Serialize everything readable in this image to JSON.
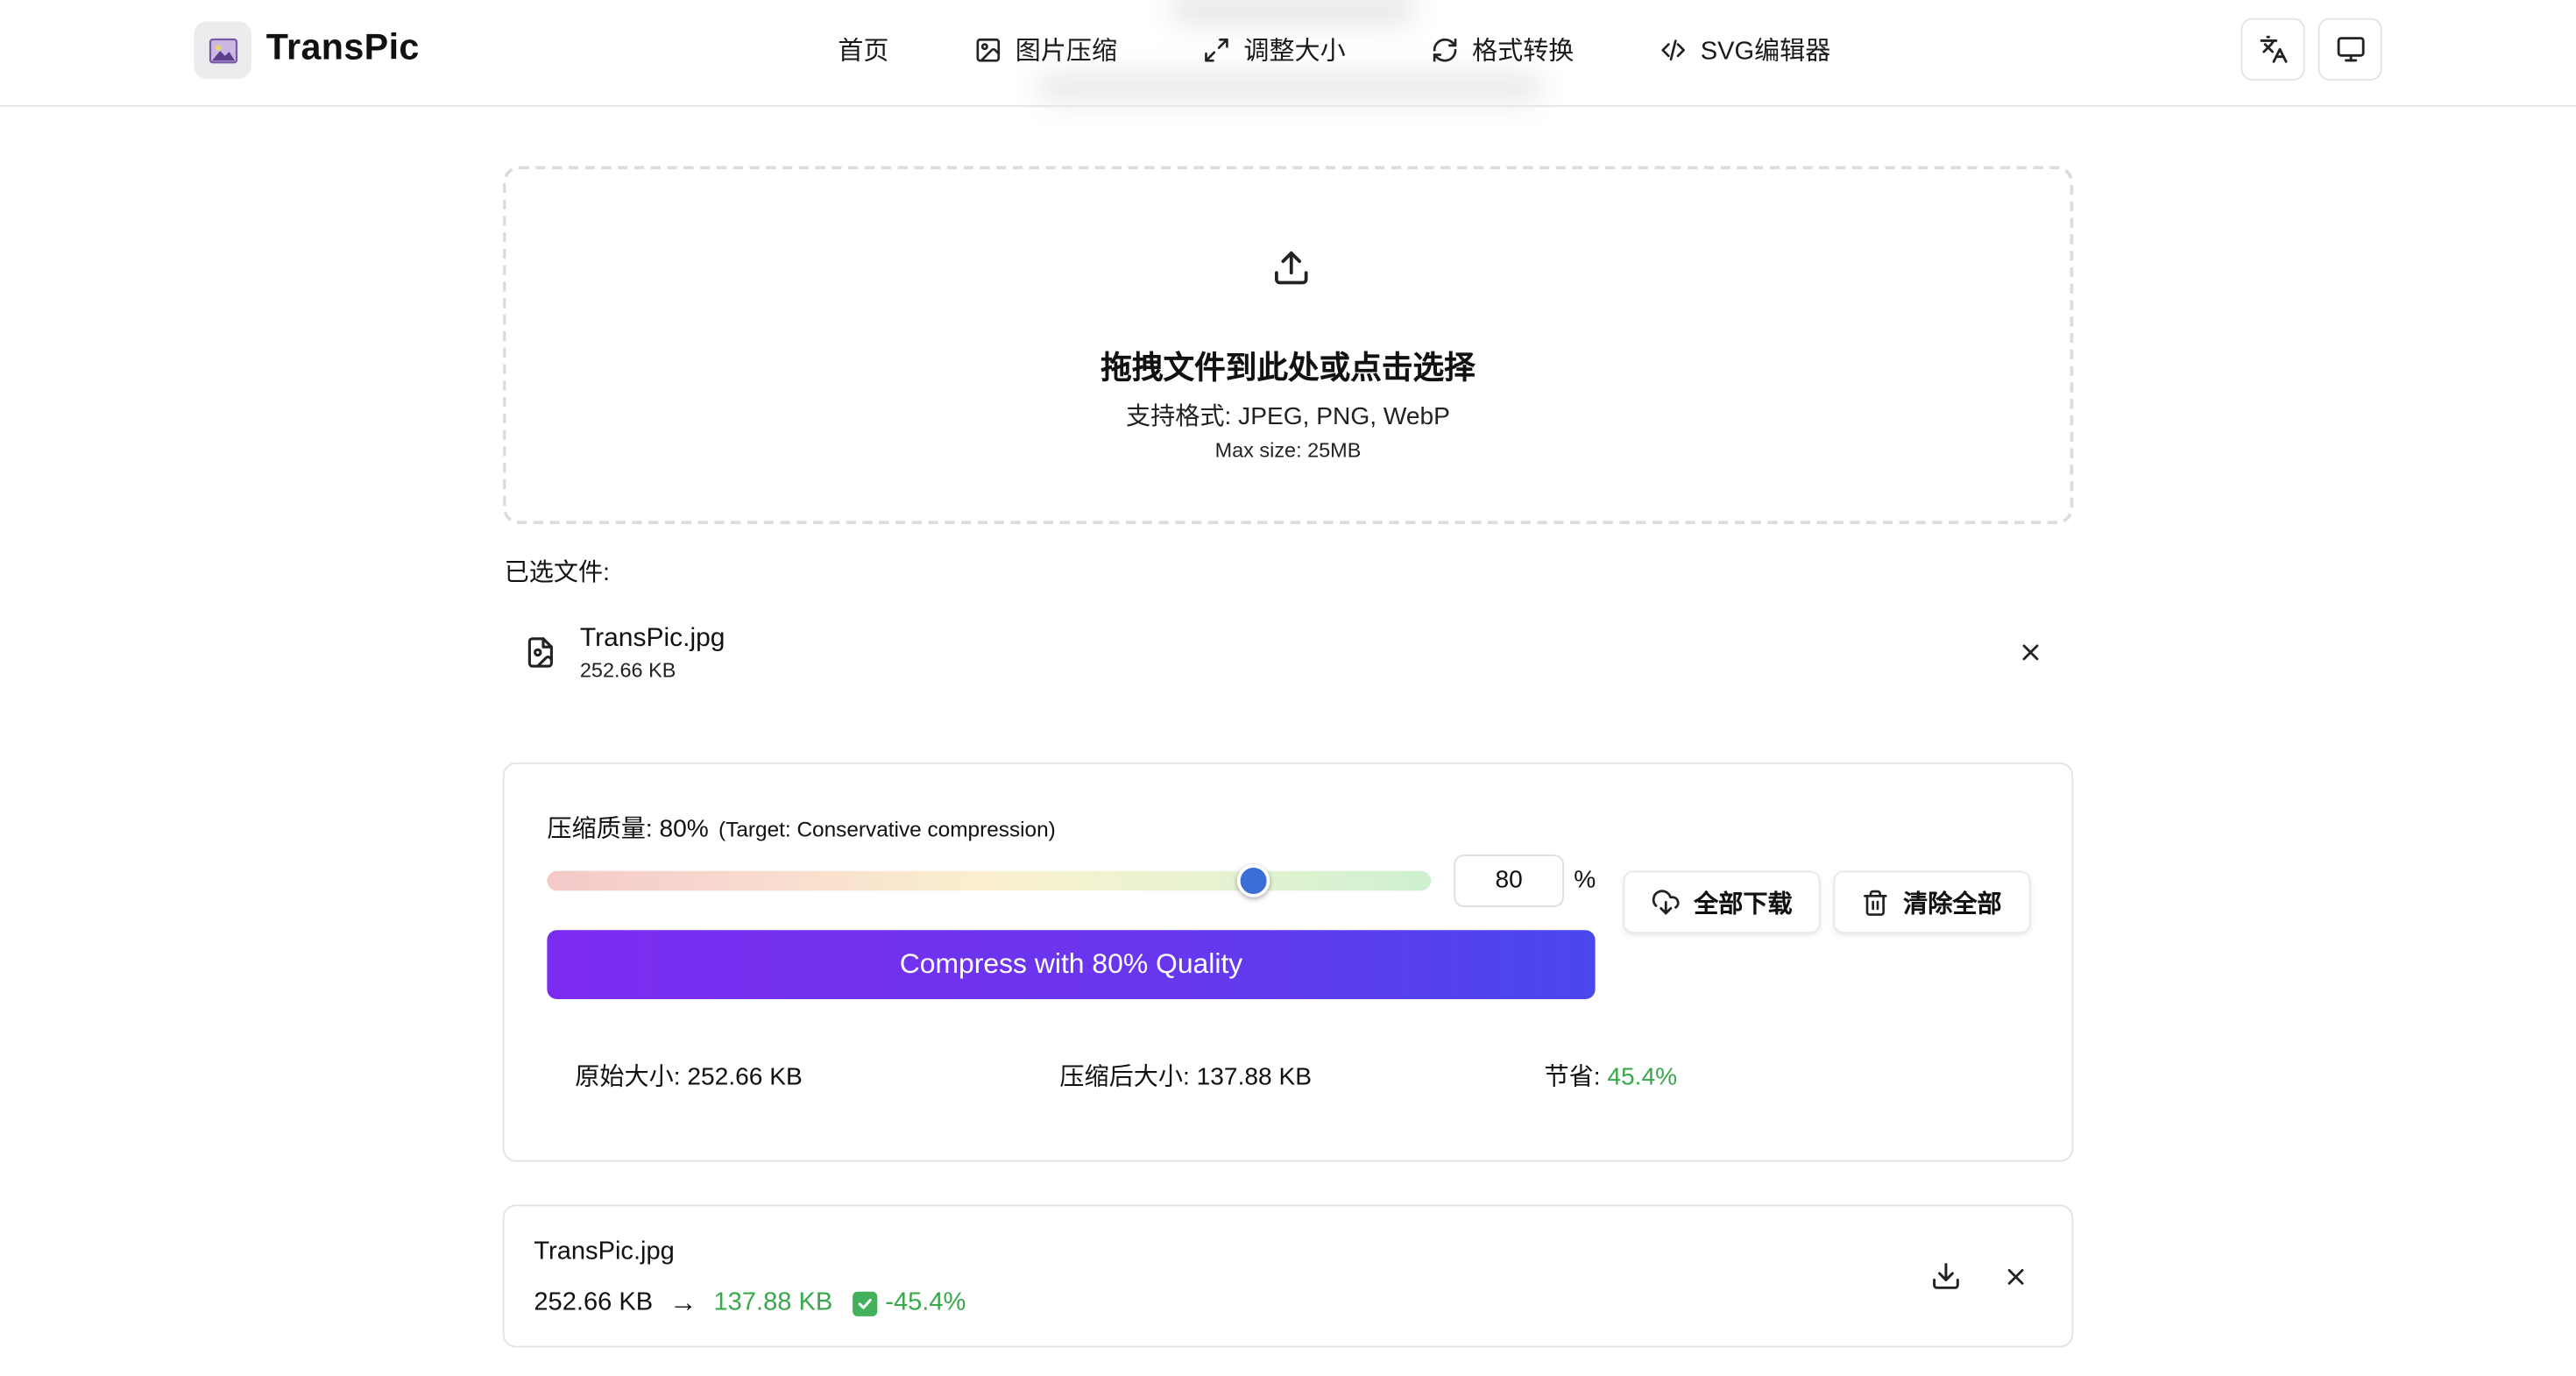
{
  "header": {
    "app_title": "TransPic",
    "nav": [
      {
        "label": "首页",
        "icon": "none"
      },
      {
        "label": "图片压缩",
        "icon": "image-icon"
      },
      {
        "label": "调整大小",
        "icon": "expand-icon"
      },
      {
        "label": "格式转换",
        "icon": "refresh-icon"
      },
      {
        "label": "SVG编辑器",
        "icon": "code-icon"
      }
    ],
    "buttons": [
      {
        "icon": "translate-icon"
      },
      {
        "icon": "monitor-icon"
      }
    ]
  },
  "upload": {
    "title": "拖拽文件到此处或点击选择",
    "formats": "支持格式: JPEG, PNG, WebP",
    "max_size": "Max size: 25MB"
  },
  "selected": {
    "label": "已选文件:",
    "file": {
      "name": "TransPic.jpg",
      "size": "252.66 KB"
    }
  },
  "compression": {
    "quality_label": "压缩质量: 80%",
    "target_note": "(Target: Conservative compression)",
    "quality_value": 80,
    "quality_input": "80",
    "percent_sign": "%",
    "compress_button": "Compress with 80% Quality",
    "download_all": "全部下载",
    "clear_all": "清除全部",
    "stats": {
      "original_label": "原始大小:",
      "original_value": "252.66 KB",
      "compressed_label": "压缩后大小:",
      "compressed_value": "137.88 KB",
      "saved_label": "节省:",
      "saved_value": "45.4%"
    },
    "colors": {
      "accent_start": "#7c2cf0",
      "accent_end": "#4a47ec",
      "success": "#38a84a",
      "thumb": "#3b6fd6"
    }
  },
  "result": {
    "name": "TransPic.jpg",
    "original": "252.66 KB",
    "arrow": "→",
    "compressed": "137.88 KB",
    "reduction": "-45.4%"
  }
}
